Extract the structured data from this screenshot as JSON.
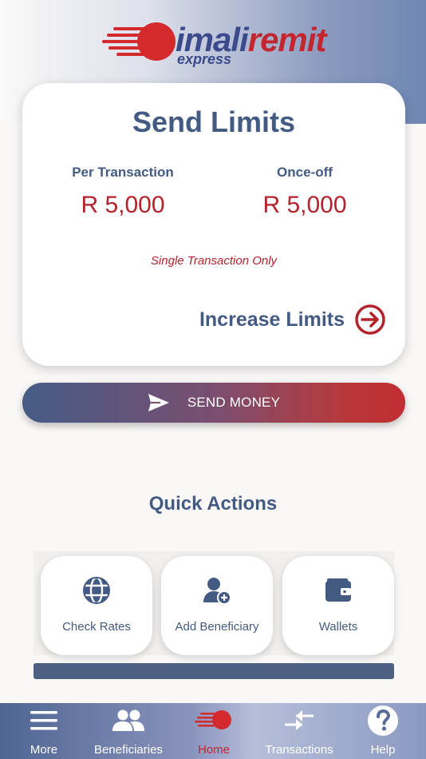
{
  "brand": {
    "name_part1": "imali",
    "name_part2": "remit",
    "sub": "express",
    "accent": "#c3262f",
    "navy": "#3b4a8c"
  },
  "limits": {
    "title": "Send Limits",
    "per_transaction_label": "Per Transaction",
    "per_transaction_value": "R 5,000",
    "once_off_label": "Once-off",
    "once_off_value": "R 5,000",
    "note": "Single Transaction Only",
    "increase_label": "Increase Limits",
    "increase_icon": "arrow-circle-right-icon"
  },
  "send_money": {
    "label": "SEND MONEY",
    "icon": "paper-plane-icon"
  },
  "quick_actions": {
    "title": "Quick Actions",
    "items": [
      {
        "label": "Check Rates",
        "icon": "globe-icon"
      },
      {
        "label": "Add Beneficiary",
        "icon": "add-user-icon"
      },
      {
        "label": "Wallets",
        "icon": "wallet-icon"
      }
    ]
  },
  "tabbar": {
    "items": [
      {
        "label": "More",
        "icon": "menu-icon"
      },
      {
        "label": "Beneficiaries",
        "icon": "people-icon"
      },
      {
        "label": "Home",
        "icon": "home-logo-icon",
        "active": true
      },
      {
        "label": "Transactions",
        "icon": "transfer-arrows-icon"
      },
      {
        "label": "Help",
        "icon": "help-icon"
      }
    ]
  }
}
